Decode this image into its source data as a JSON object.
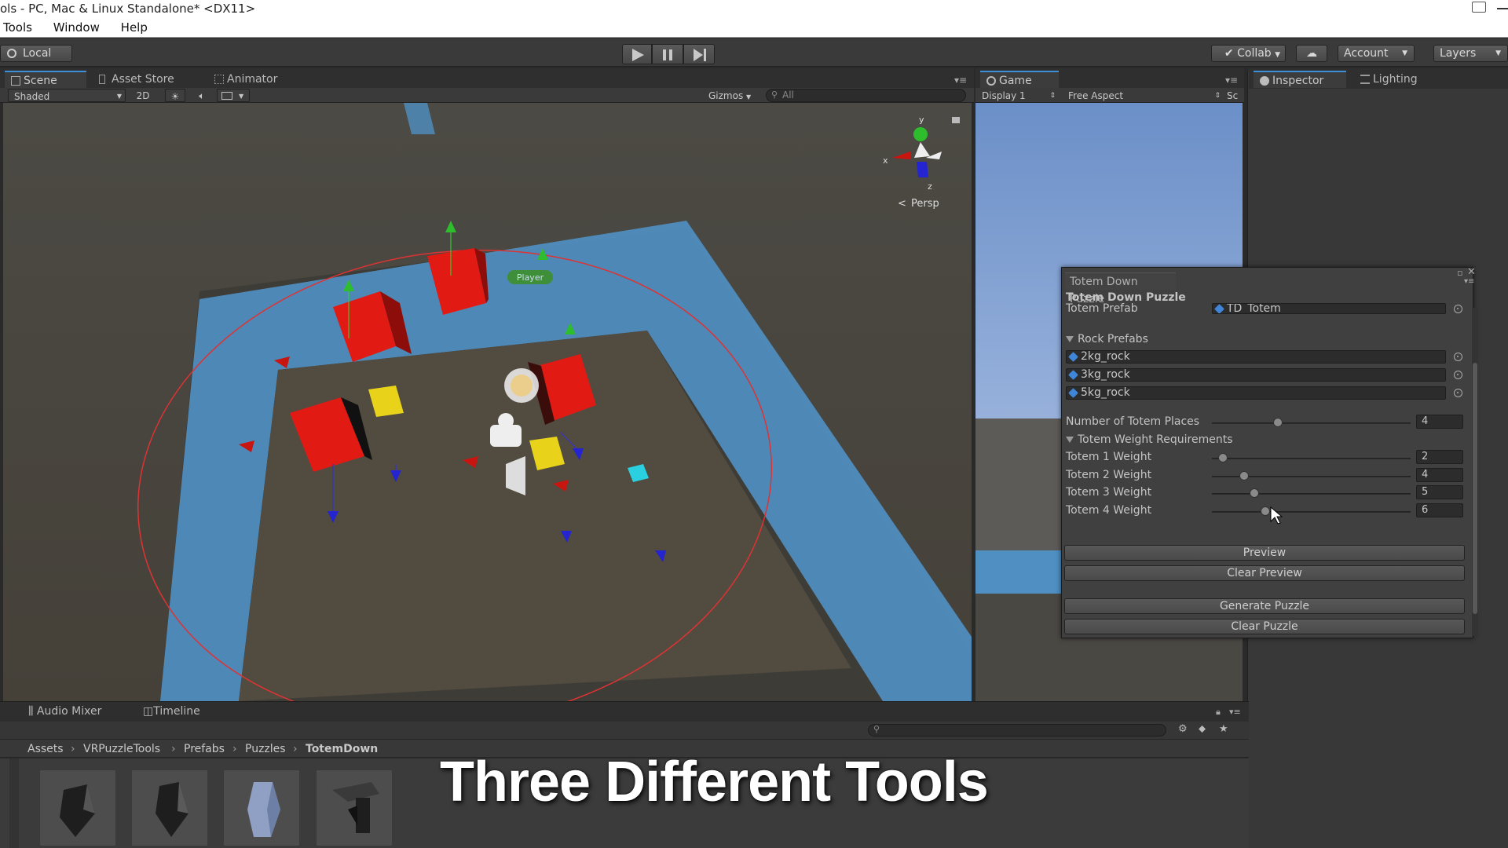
{
  "window": {
    "title": "ols - PC, Mac & Linux Standalone* <DX11>"
  },
  "menu": {
    "items": [
      "Tools",
      "Window",
      "Help"
    ]
  },
  "toolbar": {
    "pivot_label": "Local",
    "collab_label": "Collab",
    "account_label": "Account",
    "layers_label": "Layers"
  },
  "scene_tabs": [
    {
      "label": "Scene",
      "active": true
    },
    {
      "label": "Asset Store",
      "active": false
    },
    {
      "label": "Animator",
      "active": false
    }
  ],
  "scene_bar": {
    "shading_mode": "Shaded",
    "mode_2d": "2D",
    "gizmos_label": "Gizmos",
    "search_placeholder": "All"
  },
  "scene_gizmo": {
    "y_label": "y",
    "x_label": "x",
    "z_label": "z",
    "projection": "Persp"
  },
  "scene_objects": {
    "player_label": "Player"
  },
  "game": {
    "tab_label": "Game",
    "display": "Display 1",
    "aspect": "Free Aspect",
    "scale_label": "Sc"
  },
  "right_tabs": {
    "inspector": "Inspector",
    "lighting": "Lighting"
  },
  "puzzle_window": {
    "tab_label": "Totem Down Puzzle",
    "header": "Totem Down Puzzle",
    "totem_prefab_label": "Totem Prefab",
    "totem_prefab_value": "TD_Totem",
    "rock_prefabs_label": "Rock Prefabs",
    "rock_prefabs": [
      "2kg_rock",
      "3kg_rock",
      "5kg_rock"
    ],
    "num_places_label": "Number of Totem Places",
    "num_places_value": "4",
    "weights_label": "Totem Weight Requirements",
    "weights": [
      {
        "label": "Totem 1 Weight",
        "value": "2"
      },
      {
        "label": "Totem 2 Weight",
        "value": "4"
      },
      {
        "label": "Totem 3 Weight",
        "value": "5"
      },
      {
        "label": "Totem 4 Weight",
        "value": "6"
      }
    ],
    "buttons": {
      "preview": "Preview",
      "clear_preview": "Clear Preview",
      "generate": "Generate Puzzle",
      "clear_puzzle": "Clear Puzzle"
    }
  },
  "bottom_tabs": {
    "audio_mixer": "Audio Mixer",
    "timeline": "Timeline"
  },
  "project": {
    "breadcrumb": [
      "Assets",
      "VRPuzzleTools",
      "Prefabs",
      "Puzzles",
      "TotemDown"
    ]
  },
  "caption": "Three Different Tools",
  "colors": {
    "accent": "#3c8fd8",
    "scene_ground": "#4a4640",
    "path_blue": "#4f8fc2",
    "box_red": "#e21a14",
    "box_yellow": "#e8d21a",
    "sky_blue": "#7d9ccc"
  }
}
